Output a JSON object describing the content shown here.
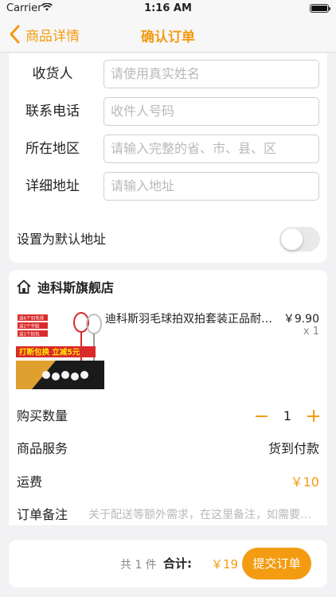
{
  "status": {
    "carrier": "Carrier",
    "time": "1:16 AM"
  },
  "nav": {
    "back_label": "商品详情",
    "title": "确认订单"
  },
  "address": {
    "fields": [
      {
        "label": "收货人",
        "placeholder": "请使用真实姓名"
      },
      {
        "label": "联系电话",
        "placeholder": "收件人号码"
      },
      {
        "label": "所在地区",
        "placeholder": "请输入完整的省、市、县、区"
      },
      {
        "label": "详细地址",
        "placeholder": "请输入地址"
      }
    ]
  },
  "default_address": {
    "label": "设置为默认地址",
    "enabled": false
  },
  "order": {
    "store_name": "迪科斯旗舰店",
    "product": {
      "name": "迪科斯羽毛球拍双拍套装正品耐打超轻",
      "price": "￥9.90",
      "qty": "x 1",
      "image_texts": {
        "line1": "送6个羽毛球",
        "line2": "送2个手胶",
        "line3": "送1个拍包",
        "banner": "打断包换 立减5元"
      }
    },
    "quantity": {
      "label": "购买数量",
      "value": "1"
    },
    "service": {
      "label": "商品服务",
      "value": "货到付款"
    },
    "shipping": {
      "label": "运费",
      "value": "￥10"
    },
    "remark": {
      "label": "订单备注",
      "placeholder": "关于配送等额外需求，在这里备注，如需要送货时间"
    }
  },
  "footer": {
    "count": "共 1 件",
    "total_label": "合计:",
    "total": "￥19",
    "submit_label": "提交订单"
  },
  "colors": {
    "accent": "#f39c12",
    "background": "#f2f2f4"
  }
}
